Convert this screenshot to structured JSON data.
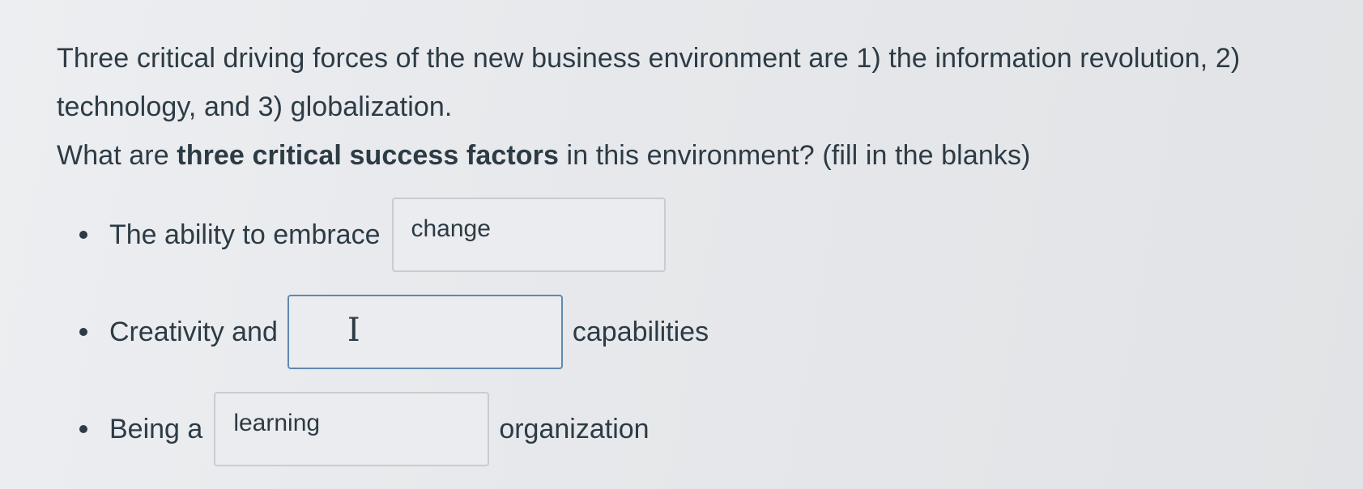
{
  "question": {
    "line1": "Three critical driving forces of the new business environment are 1) the information revolution, 2) technology, and 3) globalization.",
    "line2_prefix": "What are ",
    "line2_bold": "three critical success factors",
    "line2_suffix": " in this environment? (fill in the blanks)"
  },
  "blanks": [
    {
      "before": "The ability to embrace",
      "value": "change",
      "after": ""
    },
    {
      "before": "Creativity and",
      "value": "",
      "after": "capabilities"
    },
    {
      "before": "Being a",
      "value": "learning",
      "after": "organization"
    }
  ],
  "cursor_glyph": "I"
}
